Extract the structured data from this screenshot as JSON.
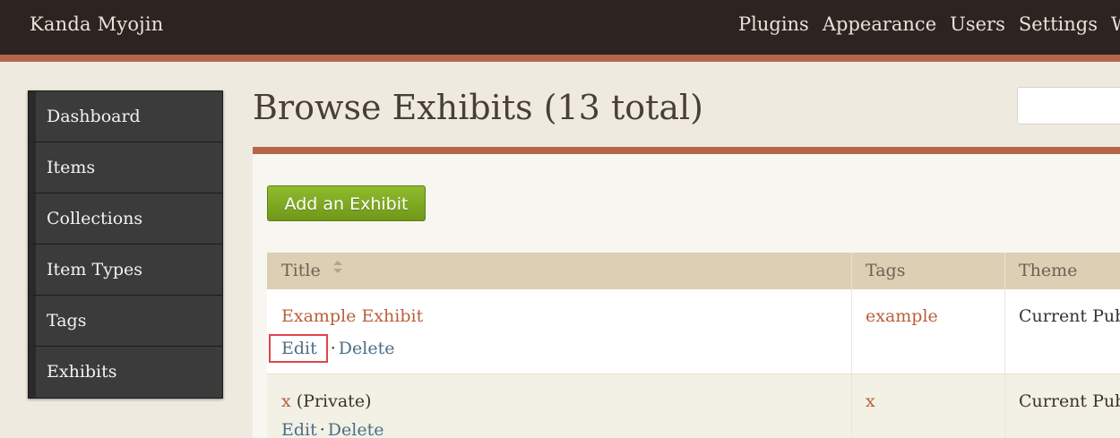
{
  "topbar": {
    "site_title": "Kanda Myojin",
    "nav": [
      "Plugins",
      "Appearance",
      "Users",
      "Settings",
      "W"
    ]
  },
  "sidebar": {
    "items": [
      {
        "label": "Dashboard"
      },
      {
        "label": "Items"
      },
      {
        "label": "Collections"
      },
      {
        "label": "Item Types"
      },
      {
        "label": "Tags"
      },
      {
        "label": "Exhibits"
      }
    ]
  },
  "main": {
    "title": "Browse Exhibits (13 total)",
    "add_button": "Add an Exhibit",
    "table": {
      "headers": {
        "title": "Title",
        "tags": "Tags",
        "theme": "Theme"
      },
      "rows": [
        {
          "title": "Example Exhibit",
          "private_label": "",
          "edit": "Edit",
          "separator": "·",
          "delete": "Delete",
          "tags": "example",
          "theme": "Current Public Theme"
        },
        {
          "title": "x",
          "private_label": "(Private)",
          "edit": "Edit",
          "separator": "·",
          "delete": "Delete",
          "tags": "x",
          "theme": "Current Public Theme"
        }
      ]
    }
  },
  "colors": {
    "topbar": "#2b2421",
    "accent": "#b4664a",
    "sidebar": "#3b3b3b",
    "button": "#7aa61f",
    "highlight": "#e0434a"
  }
}
